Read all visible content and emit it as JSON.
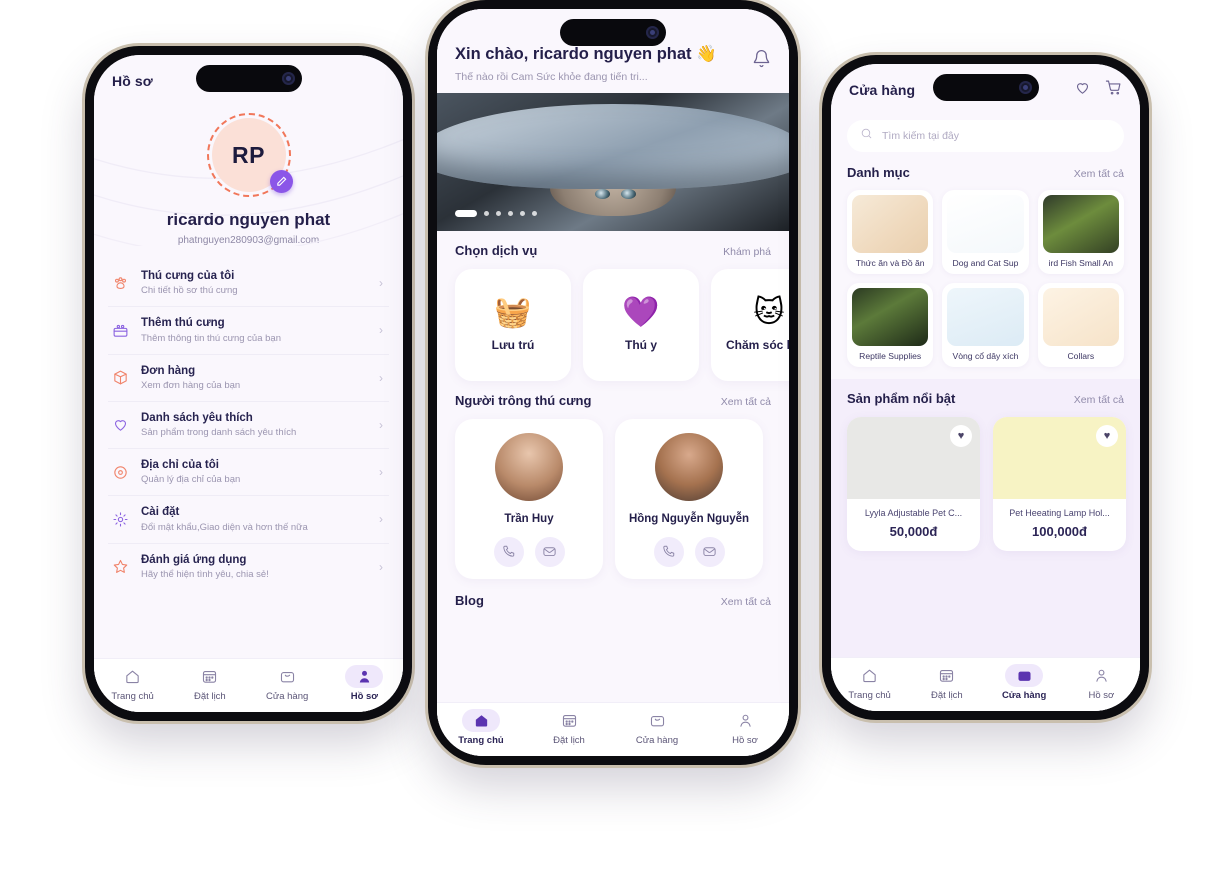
{
  "app": {
    "accent": "#7c4ddb",
    "accent_soft": "#efe8fb",
    "background": "#ffffff",
    "screen_bg": "#faf7fd",
    "text_dark": "#241f4a",
    "text_muted": "#9b95b0",
    "coral": "#f1775a"
  },
  "profile_screen": {
    "title": "Hồ sơ",
    "avatar_initials": "RP",
    "edit_icon": "pencil-icon",
    "name": "ricardo nguyen phat",
    "email": "phatnguyen280903@gmail.com",
    "menu": [
      {
        "icon": "paw-icon",
        "title": "Thú cưng của tôi",
        "subtitle": "Chi tiết hồ sơ thú cưng"
      },
      {
        "icon": "pet-add-icon",
        "title": "Thêm thú cưng",
        "subtitle": "Thêm thông tin thú cưng của bạn"
      },
      {
        "icon": "box-icon",
        "title": "Đơn hàng",
        "subtitle": "Xem đơn hàng của bạn"
      },
      {
        "icon": "heart-icon",
        "title": "Danh sách yêu thích",
        "subtitle": "Sản phẩm trong danh sách yêu thích"
      },
      {
        "icon": "location-icon",
        "title": "Địa chỉ của tôi",
        "subtitle": "Quản lý địa chỉ của bạn"
      },
      {
        "icon": "gear-icon",
        "title": "Cài đặt",
        "subtitle": "Đổi mật khẩu,Giao diện và hơn thế nữa"
      },
      {
        "icon": "star-icon",
        "title": "Đánh giá ứng dụng",
        "subtitle": "Hãy thể hiện tình yêu, chia sẻ!"
      }
    ],
    "chevron": "›",
    "tabs": [
      {
        "label": "Trang chủ",
        "icon": "home-icon",
        "active": false
      },
      {
        "label": "Đặt lịch",
        "icon": "calendar-icon",
        "active": false
      },
      {
        "label": "Cửa hàng",
        "icon": "shop-bag-icon",
        "active": false
      },
      {
        "label": "Hồ sơ",
        "icon": "person-icon",
        "active": true
      }
    ]
  },
  "home_screen": {
    "greeting": "Xin chào, ricardo nguyen phat 👋",
    "subgreeting": "Thế nào rồi Cam Sức khỏe đang tiến tri...",
    "bell_icon": "bell-icon",
    "carousel": {
      "total_dots": 6,
      "active_index": 0
    },
    "services_section": {
      "title": "Chọn dịch vụ",
      "more": "Khám phá",
      "items": [
        {
          "label": "Lưu trú",
          "emoji": "🧺"
        },
        {
          "label": "Thú y",
          "emoji": "💜"
        },
        {
          "label": "Chăm sóc lông",
          "emoji": "🐱"
        }
      ]
    },
    "sitters_section": {
      "title": "Người trông thú cưng",
      "more": "Xem tất cả",
      "items": [
        {
          "name": "Trần Huy",
          "call_icon": "phone-icon",
          "mail_icon": "mail-icon"
        },
        {
          "name": "Hồng Nguyễn Nguyễn",
          "call_icon": "phone-icon",
          "mail_icon": "mail-icon"
        }
      ]
    },
    "blog_section": {
      "title": "Blog",
      "more": "Xem tất cả"
    },
    "tabs": [
      {
        "label": "Trang chủ",
        "icon": "home-icon",
        "active": true
      },
      {
        "label": "Đặt lịch",
        "icon": "calendar-icon",
        "active": false
      },
      {
        "label": "Cửa hàng",
        "icon": "shop-bag-icon",
        "active": false
      },
      {
        "label": "Hồ sơ",
        "icon": "person-icon",
        "active": false
      }
    ]
  },
  "store_screen": {
    "title": "Cửa hàng",
    "heart_icon": "heart-icon",
    "cart_icon": "cart-icon",
    "search": {
      "placeholder": "Tìm kiếm tại đây",
      "icon": "search-icon",
      "value": ""
    },
    "categories_section": {
      "title": "Danh mục",
      "more": "Xem tất cả",
      "items": [
        {
          "label": "Thức ăn và Đồ ăn"
        },
        {
          "label": "Dog and Cat Sup"
        },
        {
          "label": "ird Fish Small An"
        },
        {
          "label": "Reptile Supplies"
        },
        {
          "label": "Vòng cổ dây xích"
        },
        {
          "label": "Collars"
        }
      ]
    },
    "featured_section": {
      "title": "Sản phẩm nổi bật",
      "more": "Xem tất cả",
      "items": [
        {
          "name": "Lyyla Adjustable Pet C...",
          "price": "50,000đ",
          "fav_icon": "heart-filled-icon",
          "swatch": "#e8e8e6"
        },
        {
          "name": "Pet Heeating Lamp Hol...",
          "price": "100,000đ",
          "fav_icon": "heart-filled-icon",
          "swatch": "#f7f3c4"
        }
      ]
    },
    "tabs": [
      {
        "label": "Trang chủ",
        "icon": "home-icon",
        "active": false
      },
      {
        "label": "Đặt lịch",
        "icon": "calendar-icon",
        "active": false
      },
      {
        "label": "Cửa hàng",
        "icon": "shop-bag-icon",
        "active": true
      },
      {
        "label": "Hồ sơ",
        "icon": "person-icon",
        "active": false
      }
    ]
  }
}
